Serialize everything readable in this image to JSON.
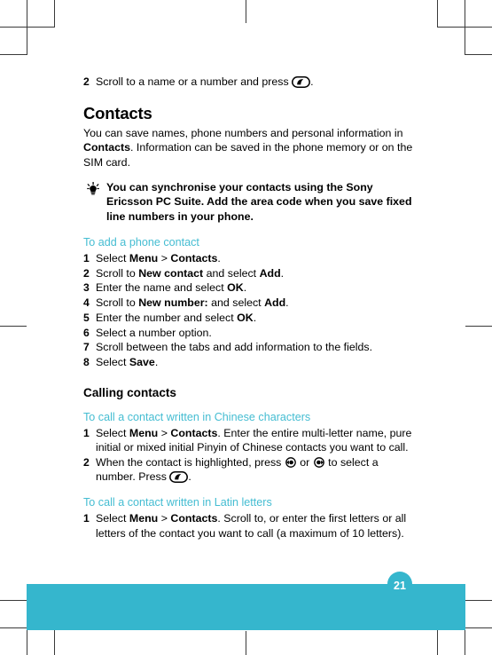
{
  "theme": {
    "accent_teal": "#35b6cd",
    "heading_teal": "#45bdd2",
    "text_black": "#000000",
    "crop_mark": "#3a3a3a"
  },
  "top_step": {
    "num": "2",
    "text_before": "Scroll to a name or a number and press ",
    "icon": "call-key-icon",
    "text_after": "."
  },
  "section": {
    "title": "Contacts",
    "intro_1": "You can save names, phone numbers and personal information in ",
    "intro_bold": "Contacts",
    "intro_2": ". Information can be saved in the phone memory or on the SIM card."
  },
  "tip": {
    "icon": "lightbulb-tip-icon",
    "text": "You can synchronise your contacts using the Sony Ericsson PC Suite. Add the area code when you save fixed line numbers in your phone."
  },
  "procedures": [
    {
      "title": "To add a phone contact",
      "steps": [
        {
          "num": "1",
          "parts": [
            {
              "t": "Select "
            },
            {
              "b": "Menu"
            },
            {
              "t": " > "
            },
            {
              "b": "Contacts"
            },
            {
              "t": "."
            }
          ]
        },
        {
          "num": "2",
          "parts": [
            {
              "t": "Scroll to "
            },
            {
              "b": "New contact"
            },
            {
              "t": " and select "
            },
            {
              "b": "Add"
            },
            {
              "t": "."
            }
          ]
        },
        {
          "num": "3",
          "parts": [
            {
              "t": "Enter the name and select "
            },
            {
              "b": "OK"
            },
            {
              "t": "."
            }
          ]
        },
        {
          "num": "4",
          "parts": [
            {
              "t": "Scroll to "
            },
            {
              "b": "New number:"
            },
            {
              "t": " and select "
            },
            {
              "b": "Add"
            },
            {
              "t": "."
            }
          ]
        },
        {
          "num": "5",
          "parts": [
            {
              "t": "Enter the number and select "
            },
            {
              "b": "OK"
            },
            {
              "t": "."
            }
          ]
        },
        {
          "num": "6",
          "parts": [
            {
              "t": "Select a number option."
            }
          ]
        },
        {
          "num": "7",
          "parts": [
            {
              "t": "Scroll between the tabs and add information to the fields."
            }
          ]
        },
        {
          "num": "8",
          "parts": [
            {
              "t": "Select "
            },
            {
              "b": "Save"
            },
            {
              "t": "."
            }
          ]
        }
      ]
    }
  ],
  "subsection": {
    "title": "Calling contacts",
    "procedures": [
      {
        "title": "To call a contact written in Chinese characters",
        "steps": [
          {
            "num": "1",
            "parts": [
              {
                "t": "Select "
              },
              {
                "b": "Menu"
              },
              {
                "t": " > "
              },
              {
                "b": "Contacts"
              },
              {
                "t": ". Enter the entire multi-letter name, pure initial or mixed initial Pinyin of Chinese contacts you want to call."
              }
            ]
          },
          {
            "num": "2",
            "parts": [
              {
                "t": "When the contact is highlighted, press "
              },
              {
                "icon": "nav-left-key-icon"
              },
              {
                "t": " or "
              },
              {
                "icon": "nav-right-key-icon"
              },
              {
                "t": " to select a number. Press "
              },
              {
                "icon": "call-key-icon"
              },
              {
                "t": "."
              }
            ]
          }
        ]
      },
      {
        "title": "To call a contact written in Latin letters",
        "steps": [
          {
            "num": "1",
            "parts": [
              {
                "t": "Select "
              },
              {
                "b": "Menu"
              },
              {
                "t": " > "
              },
              {
                "b": "Contacts"
              },
              {
                "t": ". Scroll to, or enter the first letters or all letters of the contact you want to call (a maximum of 10 letters)."
              }
            ]
          }
        ]
      }
    ]
  },
  "footer": {
    "page_number": "21"
  }
}
